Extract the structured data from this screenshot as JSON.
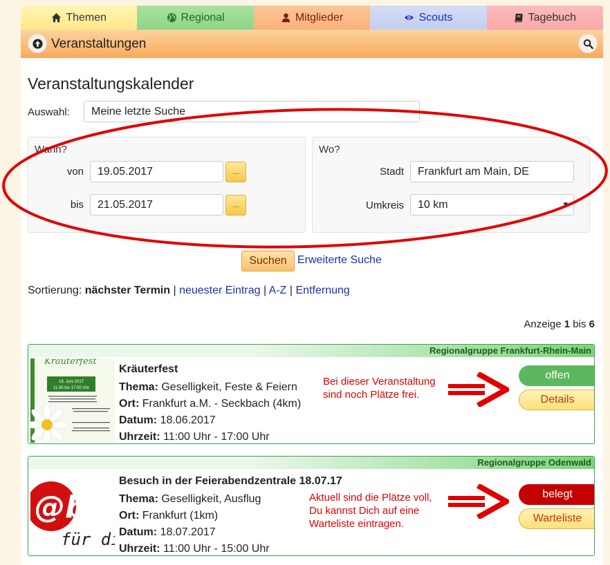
{
  "nav": {
    "tabs": [
      {
        "label": "Themen",
        "icon": "home-icon"
      },
      {
        "label": "Regional",
        "icon": "globe-icon"
      },
      {
        "label": "Mitglieder",
        "icon": "user-icon"
      },
      {
        "label": "Scouts",
        "icon": "eye-icon"
      },
      {
        "label": "Tagebuch",
        "icon": "book-icon"
      }
    ]
  },
  "subbar": {
    "title": "Veranstaltungen"
  },
  "page": {
    "heading": "Veranstaltungskalender"
  },
  "auswahl": {
    "label": "Auswahl:",
    "value": "Meine letzte Suche"
  },
  "wann": {
    "title": "Wann?",
    "von_label": "von",
    "von_value": "19.05.2017",
    "bis_label": "bis",
    "bis_value": "21.05.2017",
    "picker_label": "..."
  },
  "wo": {
    "title": "Wo?",
    "stadt_label": "Stadt",
    "stadt_value": "Frankfurt am Main, DE",
    "umkreis_label": "Umkreis",
    "umkreis_value": "10 km"
  },
  "search": {
    "button": "Suchen",
    "advanced": "Erweiterte Suche"
  },
  "sort": {
    "label": "Sortierung:",
    "active": "nächster Termin",
    "sep": "|",
    "options": [
      "neuester Eintrag",
      "A-Z",
      "Entfernung"
    ]
  },
  "anzeige": {
    "prefix": "Anzeige",
    "from": "1",
    "mid": "bis",
    "to": "6"
  },
  "events": [
    {
      "group": "Regionalgruppe Frankfurt-Rhein-Main",
      "title": "Kräuterfest",
      "thema_label": "Thema:",
      "thema": "Geselligkeit, Feste & Feiern",
      "ort_label": "Ort:",
      "ort": "Frankfurt a.M. - Seckbach (4km)",
      "datum_label": "Datum:",
      "datum": "18.06.2017",
      "uhrzeit_label": "Uhrzeit:",
      "uhrzeit": "11:00 Uhr - 17:00 Uhr",
      "note": [
        "Bei dieser Veranstaltung",
        "sind noch Plätze frei."
      ],
      "status": "offen",
      "status_color": "#5cb85c",
      "action": "Details",
      "thumb": {
        "title": "Kräuterfest",
        "date": "18. Juni 2017",
        "time": "11.00 bis 17.00 Uhr"
      }
    },
    {
      "group": "Regionalgruppe Odenwald",
      "title": "Besuch in der Feierabendzentrale 18.07.17",
      "thema_label": "Thema:",
      "thema": "Geselligkeit, Ausflug",
      "ort_label": "Ort:",
      "ort": "Frankfurt (1km)",
      "datum_label": "Datum:",
      "datum": "18.07.2017",
      "uhrzeit_label": "Uhrzeit:",
      "uhrzeit": "11:00 Uhr - 15:00 Uhr",
      "note": [
        "Aktuell sind die Plätze voll,",
        "Du kannst Dich auf eine",
        "Warteliste eintragen."
      ],
      "status": "belegt",
      "status_color": "#c40000",
      "action": "Warteliste",
      "thumb": {
        "logo_text": "@be",
        "sub_text": "für die"
      }
    }
  ],
  "colors": {
    "annotation": "#e00000",
    "accent_orange": "#f9a95b",
    "link": "#1d2fa8"
  }
}
